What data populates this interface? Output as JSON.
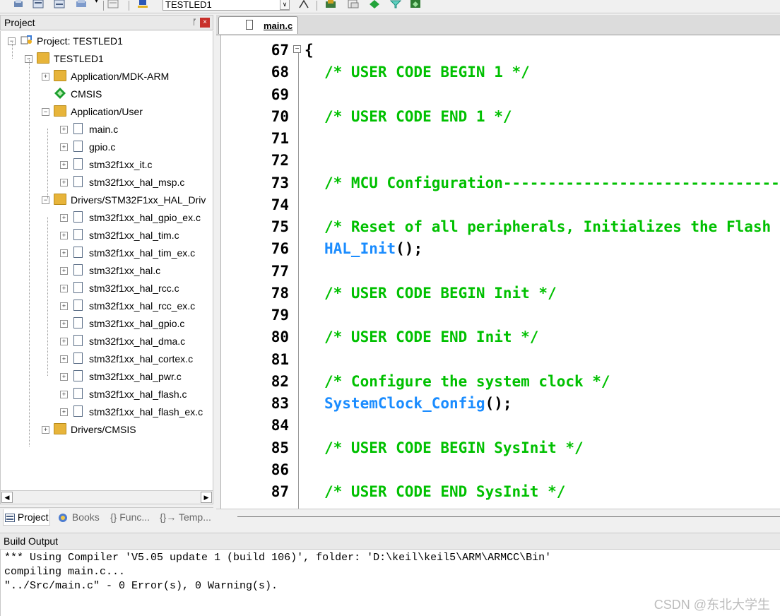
{
  "toolbar": {
    "target_name": "TESTLED1",
    "icons": [
      "translate-icon",
      "batch-build-icon",
      "build-icon",
      "load-icon",
      "download-icon",
      "target-options-icon",
      "manage-components-icon",
      "select-packs-icon",
      "manage-project-icon",
      "run-icon",
      "config-icon"
    ]
  },
  "project_panel": {
    "title": "Project",
    "pin_glyph": "ᚪ",
    "close_glyph": "×",
    "tree": [
      {
        "label": "Project: TESTLED1",
        "icon": "project-icon",
        "level": 0,
        "expander": "−"
      },
      {
        "label": "TESTLED1",
        "icon": "target-folder-icon",
        "level": 1,
        "expander": "−"
      },
      {
        "label": "Application/MDK-ARM",
        "icon": "folder-icon",
        "level": 2,
        "expander": "+"
      },
      {
        "label": "CMSIS",
        "icon": "component-icon",
        "level": 2,
        "expander": ""
      },
      {
        "label": "Application/User",
        "icon": "folder-icon",
        "level": 2,
        "expander": "−"
      },
      {
        "label": "main.c",
        "icon": "file-icon",
        "level": 3,
        "expander": "+"
      },
      {
        "label": "gpio.c",
        "icon": "file-icon",
        "level": 3,
        "expander": "+"
      },
      {
        "label": "stm32f1xx_it.c",
        "icon": "file-icon",
        "level": 3,
        "expander": "+"
      },
      {
        "label": "stm32f1xx_hal_msp.c",
        "icon": "file-icon",
        "level": 3,
        "expander": "+"
      },
      {
        "label": "Drivers/STM32F1xx_HAL_Driv",
        "icon": "folder-icon",
        "level": 2,
        "expander": "−"
      },
      {
        "label": "stm32f1xx_hal_gpio_ex.c",
        "icon": "file-icon",
        "level": 3,
        "expander": "+"
      },
      {
        "label": "stm32f1xx_hal_tim.c",
        "icon": "file-icon",
        "level": 3,
        "expander": "+"
      },
      {
        "label": "stm32f1xx_hal_tim_ex.c",
        "icon": "file-icon",
        "level": 3,
        "expander": "+"
      },
      {
        "label": "stm32f1xx_hal.c",
        "icon": "file-icon",
        "level": 3,
        "expander": "+"
      },
      {
        "label": "stm32f1xx_hal_rcc.c",
        "icon": "file-icon",
        "level": 3,
        "expander": "+"
      },
      {
        "label": "stm32f1xx_hal_rcc_ex.c",
        "icon": "file-icon",
        "level": 3,
        "expander": "+"
      },
      {
        "label": "stm32f1xx_hal_gpio.c",
        "icon": "file-icon",
        "level": 3,
        "expander": "+"
      },
      {
        "label": "stm32f1xx_hal_dma.c",
        "icon": "file-icon",
        "level": 3,
        "expander": "+"
      },
      {
        "label": "stm32f1xx_hal_cortex.c",
        "icon": "file-icon",
        "level": 3,
        "expander": "+"
      },
      {
        "label": "stm32f1xx_hal_pwr.c",
        "icon": "file-icon",
        "level": 3,
        "expander": "+"
      },
      {
        "label": "stm32f1xx_hal_flash.c",
        "icon": "file-icon",
        "level": 3,
        "expander": "+"
      },
      {
        "label": "stm32f1xx_hal_flash_ex.c",
        "icon": "file-icon",
        "level": 3,
        "expander": "+"
      },
      {
        "label": "Drivers/CMSIS",
        "icon": "folder-icon",
        "level": 2,
        "expander": "+"
      }
    ]
  },
  "bottom_tabs": [
    {
      "label": "Project",
      "icon": "project-tab-icon",
      "active": true
    },
    {
      "label": "Books",
      "icon": "books-icon",
      "active": false
    },
    {
      "label": "{} Func...",
      "icon": "",
      "active": false
    },
    {
      "label": "{}→ Temp...",
      "icon": "",
      "active": false
    }
  ],
  "editor": {
    "tab_label": "main.c",
    "lines": [
      {
        "num": "67",
        "text": "{",
        "color": "#000000"
      },
      {
        "num": "68",
        "text": "/* USER CODE BEGIN 1 */",
        "color": "#00c000"
      },
      {
        "num": "69",
        "text": "",
        "color": "#000000"
      },
      {
        "num": "70",
        "text": "/* USER CODE END 1 */",
        "color": "#00c000"
      },
      {
        "num": "71",
        "text": "",
        "color": "#000000"
      },
      {
        "num": "72",
        "text": "",
        "color": "#000000"
      },
      {
        "num": "73",
        "text": "/* MCU Configuration--------------------------------------",
        "color": "#00c000"
      },
      {
        "num": "74",
        "text": "",
        "color": "#000000"
      },
      {
        "num": "75",
        "text": "/* Reset of all peripherals, Initializes the Flash interface",
        "color": "#00c000"
      },
      {
        "num": "76",
        "text": "HAL_Init",
        "suffix": "();",
        "color": "#1a8cff"
      },
      {
        "num": "77",
        "text": "",
        "color": "#000000"
      },
      {
        "num": "78",
        "text": "/* USER CODE BEGIN Init */",
        "color": "#00c000"
      },
      {
        "num": "79",
        "text": "",
        "color": "#000000"
      },
      {
        "num": "80",
        "text": "/* USER CODE END Init */",
        "color": "#00c000"
      },
      {
        "num": "81",
        "text": "",
        "color": "#000000"
      },
      {
        "num": "82",
        "text": "/* Configure the system clock */",
        "color": "#00c000"
      },
      {
        "num": "83",
        "text": "SystemClock_Config",
        "suffix": "();",
        "color": "#1a8cff"
      },
      {
        "num": "84",
        "text": "",
        "color": "#000000"
      },
      {
        "num": "85",
        "text": "/* USER CODE BEGIN SysInit */",
        "color": "#00c000"
      },
      {
        "num": "86",
        "text": "",
        "color": "#000000"
      },
      {
        "num": "87",
        "text": "/* USER CODE END SysInit */",
        "color": "#00c000"
      }
    ]
  },
  "build_output": {
    "title": "Build Output",
    "lines": [
      "*** Using Compiler 'V5.05 update 1 (build 106)', folder: 'D:\\keil\\keil5\\ARM\\ARMCC\\Bin'",
      "compiling main.c...",
      "\"../Src/main.c\" - 0 Error(s), 0 Warning(s)."
    ]
  },
  "watermark": "CSDN @东北大学生"
}
